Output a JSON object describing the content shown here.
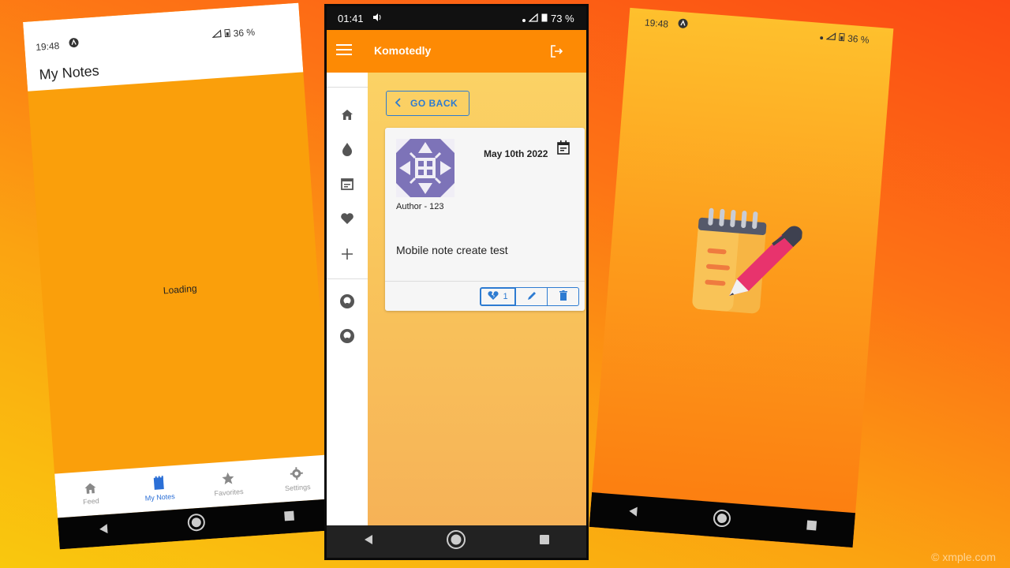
{
  "left_phone": {
    "status": {
      "time": "19:48",
      "battery": "36 %"
    },
    "title": "My Notes",
    "loading_text": "Loading",
    "tabs": [
      {
        "label": "Feed",
        "icon": "home-icon",
        "active": false
      },
      {
        "label": "My Notes",
        "icon": "notebook-icon",
        "active": true
      },
      {
        "label": "Favorites",
        "icon": "star-icon",
        "active": false
      },
      {
        "label": "Settings",
        "icon": "gear-icon",
        "active": false
      }
    ]
  },
  "center_phone": {
    "status": {
      "time": "01:41",
      "battery": "73 %"
    },
    "app_title": "Komotedly",
    "sidebar_icons": [
      "home-icon",
      "drop-icon",
      "calendar-icon",
      "heart-icon",
      "plus-icon",
      "github-icon",
      "github-icon"
    ],
    "go_back_label": "GO BACK",
    "note": {
      "date": "May 10th 2022",
      "author": "Author - 123",
      "text": "Mobile note create test",
      "favorite_count": "1"
    }
  },
  "right_phone": {
    "status": {
      "time": "19:48",
      "battery": "36 %"
    },
    "splash_icon": "notepad-pen-icon"
  },
  "watermark": "© xmple.com",
  "colors": {
    "accent_blue": "#2d7bd1",
    "header_orange": "#fd8a04",
    "nav_black": "#050505"
  }
}
